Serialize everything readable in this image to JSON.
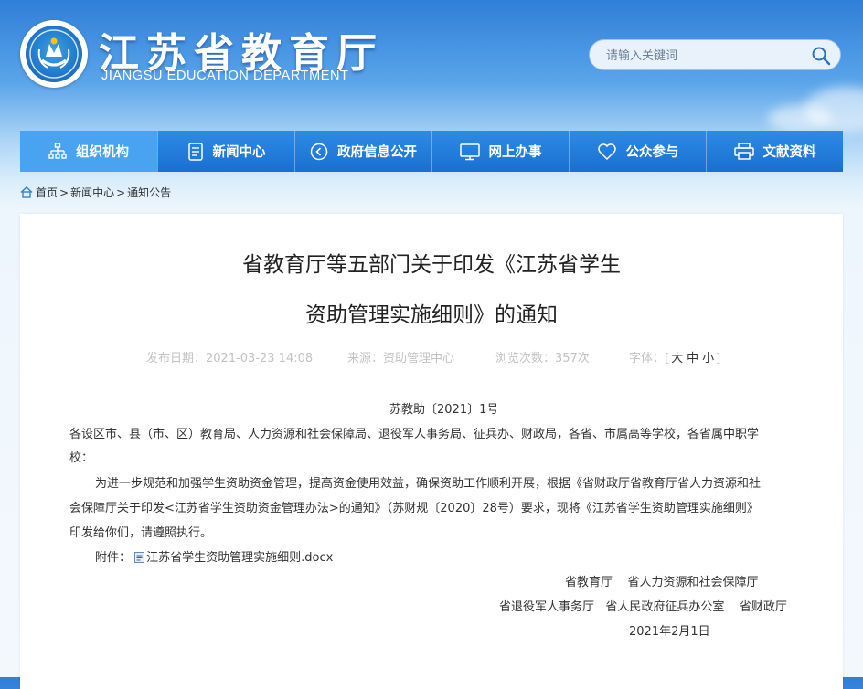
{
  "header": {
    "title": "江苏省教育厅",
    "subtitle": "JIANGSU EDUCATION DEPARTMENT",
    "search_placeholder": "请输入关键词"
  },
  "nav": [
    {
      "label": "组织机构",
      "icon": "org-chart-icon",
      "active": true
    },
    {
      "label": "新闻中心",
      "icon": "document-icon",
      "active": false
    },
    {
      "label": "政府信息公开",
      "icon": "arrow-circle-icon",
      "active": false
    },
    {
      "label": "网上办事",
      "icon": "monitor-icon",
      "active": false
    },
    {
      "label": "公众参与",
      "icon": "heart-icon",
      "active": false
    },
    {
      "label": "文献资料",
      "icon": "print-icon",
      "active": false
    }
  ],
  "breadcrumb": {
    "home": "首页",
    "news": "新闻中心",
    "notice": "通知公告"
  },
  "article": {
    "title_line1": "省教育厅等五部门关于印发《江苏省学生",
    "title_line2": "资助管理实施细则》的通知",
    "publish_date": "发布日期：2021-03-23 14:08",
    "source": "来源：资助管理中心",
    "views": "浏览次数：357次",
    "font_label": "字体：[",
    "font_large": "大",
    "font_medium": "中",
    "font_small": "小",
    "font_close": "]",
    "doc_number": "苏教助〔2021〕1号",
    "recipients_line1": "各设区市、县（市、区）教育局、人力资源和社会保障局、退役军人事务局、征兵办、财政局，各省、市属高等学校，各省属中职学",
    "recipients_line2": "校：",
    "para_line1": "为进一步规范和加强学生资助资金管理，提高资金使用效益，确保资助工作顺利开展，根据《省财政厅省教育厅省人力资源和社",
    "para_line2": "会保障厅关于印发<江苏省学生资助资金管理办法>的通知》（苏财规〔2020〕28号）要求，现将《江苏省学生资助管理实施细则》",
    "para_line3": "印发给你们，请遵照执行。",
    "attachment_label": "附件：",
    "attachment_file": "江苏省学生资助管理实施细则.docx",
    "signature_line1": "省教育厅    省人力资源和社会保障厅",
    "signature_line2": "省退役军人事务厅   省人民政府征兵办公室    省财政厅",
    "date": "2021年2月1日"
  },
  "colors": {
    "nav_bg": "#1a6fd0",
    "nav_active": "#4aa3f0",
    "meta_text": "#c2c2c2"
  }
}
